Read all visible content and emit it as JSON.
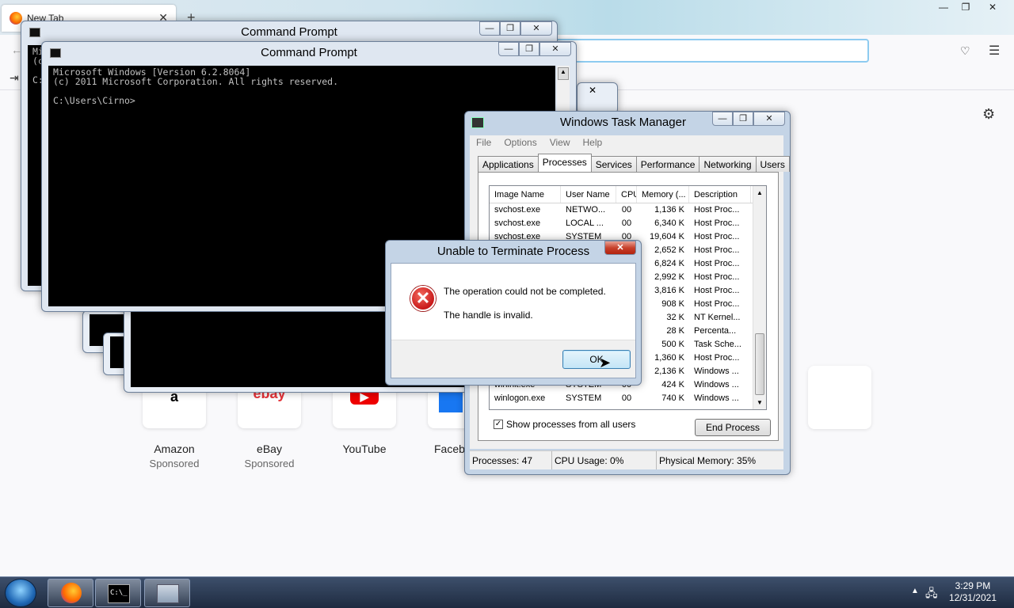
{
  "browser": {
    "tab_title": "New Tab",
    "tiles": [
      {
        "name": "Amazon",
        "sponsored": "Sponsored",
        "glyph": "a"
      },
      {
        "name": "eBay",
        "sponsored": "Sponsored",
        "glyph": "ebay"
      },
      {
        "name": "YouTube",
        "sponsored": "",
        "glyph": "▶"
      },
      {
        "name": "Faceb",
        "sponsored": "",
        "glyph": ""
      }
    ]
  },
  "cmd_back": {
    "title": "Command Prompt",
    "text": "Mi\n(c\n\nC:"
  },
  "cmd_front": {
    "title": "Command Prompt",
    "text": "Microsoft Windows [Version 6.2.8064]\n(c) 2011 Microsoft Corporation. All rights reserved.\n\nC:\\Users\\Cirno>"
  },
  "task_manager": {
    "title": "Windows Task Manager",
    "menu": [
      "File",
      "Options",
      "View",
      "Help"
    ],
    "tabs": [
      "Applications",
      "Processes",
      "Services",
      "Performance",
      "Networking",
      "Users"
    ],
    "active_tab": "Processes",
    "columns": [
      "Image Name",
      "User Name",
      "CPU",
      "Memory (...",
      "Description"
    ],
    "rows": [
      [
        "svchost.exe",
        "NETWO...",
        "00",
        "1,136 K",
        "Host Proc..."
      ],
      [
        "svchost.exe",
        "LOCAL ...",
        "00",
        "6,340 K",
        "Host Proc..."
      ],
      [
        "svchost.exe",
        "SYSTEM",
        "00",
        "19,604 K",
        "Host Proc..."
      ],
      [
        "",
        "",
        "",
        "2,652 K",
        "Host Proc..."
      ],
      [
        "",
        "",
        "",
        "6,824 K",
        "Host Proc..."
      ],
      [
        "",
        "",
        "",
        "2,992 K",
        "Host Proc..."
      ],
      [
        "",
        "",
        "",
        "3,816 K",
        "Host Proc..."
      ],
      [
        "",
        "",
        "",
        "908 K",
        "Host Proc..."
      ],
      [
        "",
        "",
        "",
        "32 K",
        "NT Kernel..."
      ],
      [
        "",
        "",
        "",
        "28 K",
        "Percenta..."
      ],
      [
        "",
        "",
        "",
        "500 K",
        "Task Sche..."
      ],
      [
        "",
        "",
        "",
        "1,360 K",
        "Host Proc..."
      ],
      [
        "",
        "",
        "",
        "2,136 K",
        "Windows ..."
      ],
      [
        "wininit.exe",
        "SYSTEM",
        "00",
        "424 K",
        "Windows ..."
      ],
      [
        "winlogon.exe",
        "SYSTEM",
        "00",
        "740 K",
        "Windows ..."
      ]
    ],
    "show_all": "Show processes from all users",
    "end_process": "End Process",
    "status": {
      "processes": "Processes: 47",
      "cpu": "CPU Usage: 0%",
      "memory": "Physical Memory: 35%"
    }
  },
  "error_dialog": {
    "title": "Unable to Terminate Process",
    "message1": "The operation could not be completed.",
    "message2": "The handle is invalid.",
    "ok": "OK"
  },
  "taskbar": {
    "time": "3:29 PM",
    "date": "12/31/2021"
  }
}
